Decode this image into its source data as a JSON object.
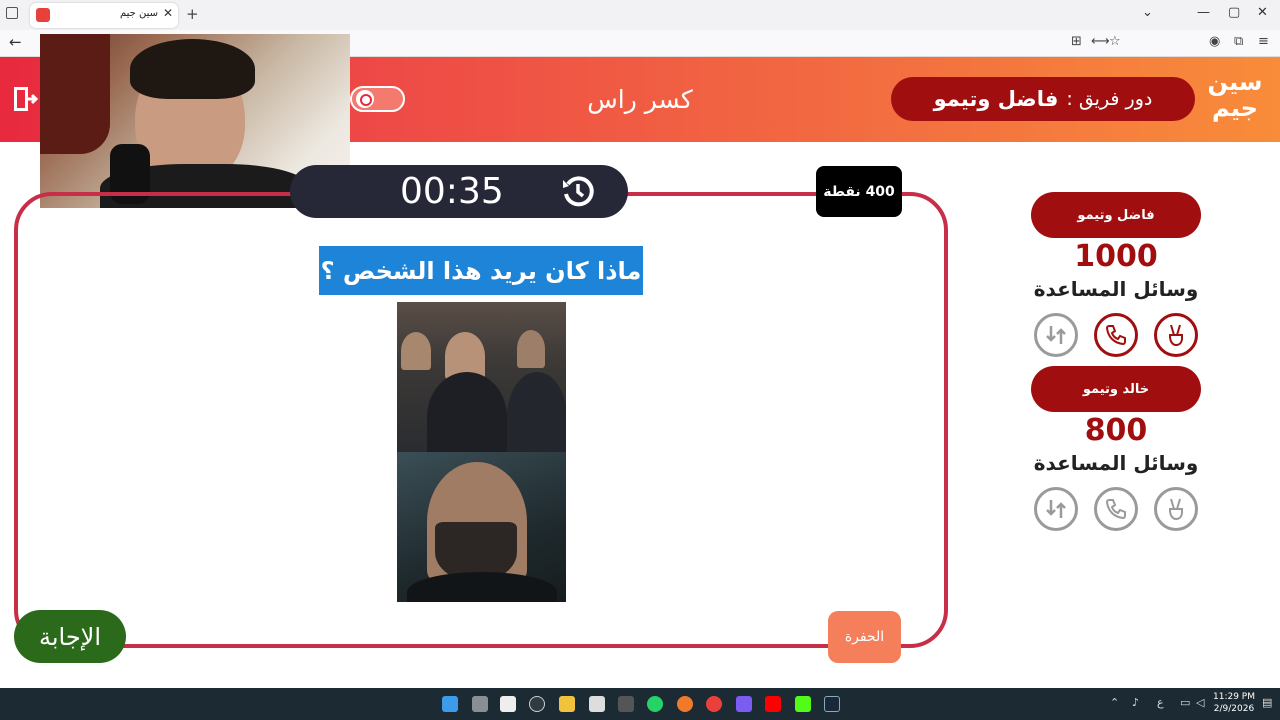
{
  "browser": {
    "tab_title": "سين جيم",
    "tab_close": "✕",
    "new_tab": "+",
    "back": "←",
    "win_min": "—",
    "win_restore": "▢",
    "win_close": "✕",
    "win_chevron": "⌄"
  },
  "header": {
    "logo": "سين جيم",
    "turn_label": "دور فريق :",
    "turn_team": "فاضل وتيمو",
    "category": "كسر راس"
  },
  "game": {
    "timer": "00:35",
    "points": "400 نقطة",
    "question": "ماذا كان يريد هذا الشخص ؟",
    "answer_button": "الإجابة",
    "pit_button": "الحفرة"
  },
  "teams": [
    {
      "name": "فاضل وتيمو",
      "score": "1000",
      "aids_label": "وسائل المساعدة"
    },
    {
      "name": "خالد وتيمو",
      "score": "800",
      "aids_label": "وسائل المساعدة"
    }
  ],
  "taskbar": {
    "clock_time": "11:29 PM",
    "clock_date": "2/9/2026",
    "lang": "ع"
  },
  "colors": {
    "accent_red": "#a10e10",
    "frame": "#c72e48",
    "question_bg": "#1d84d8",
    "answer_green": "#2b6a1a",
    "pit_orange": "#f47f5a",
    "timer_bg": "#262737"
  }
}
